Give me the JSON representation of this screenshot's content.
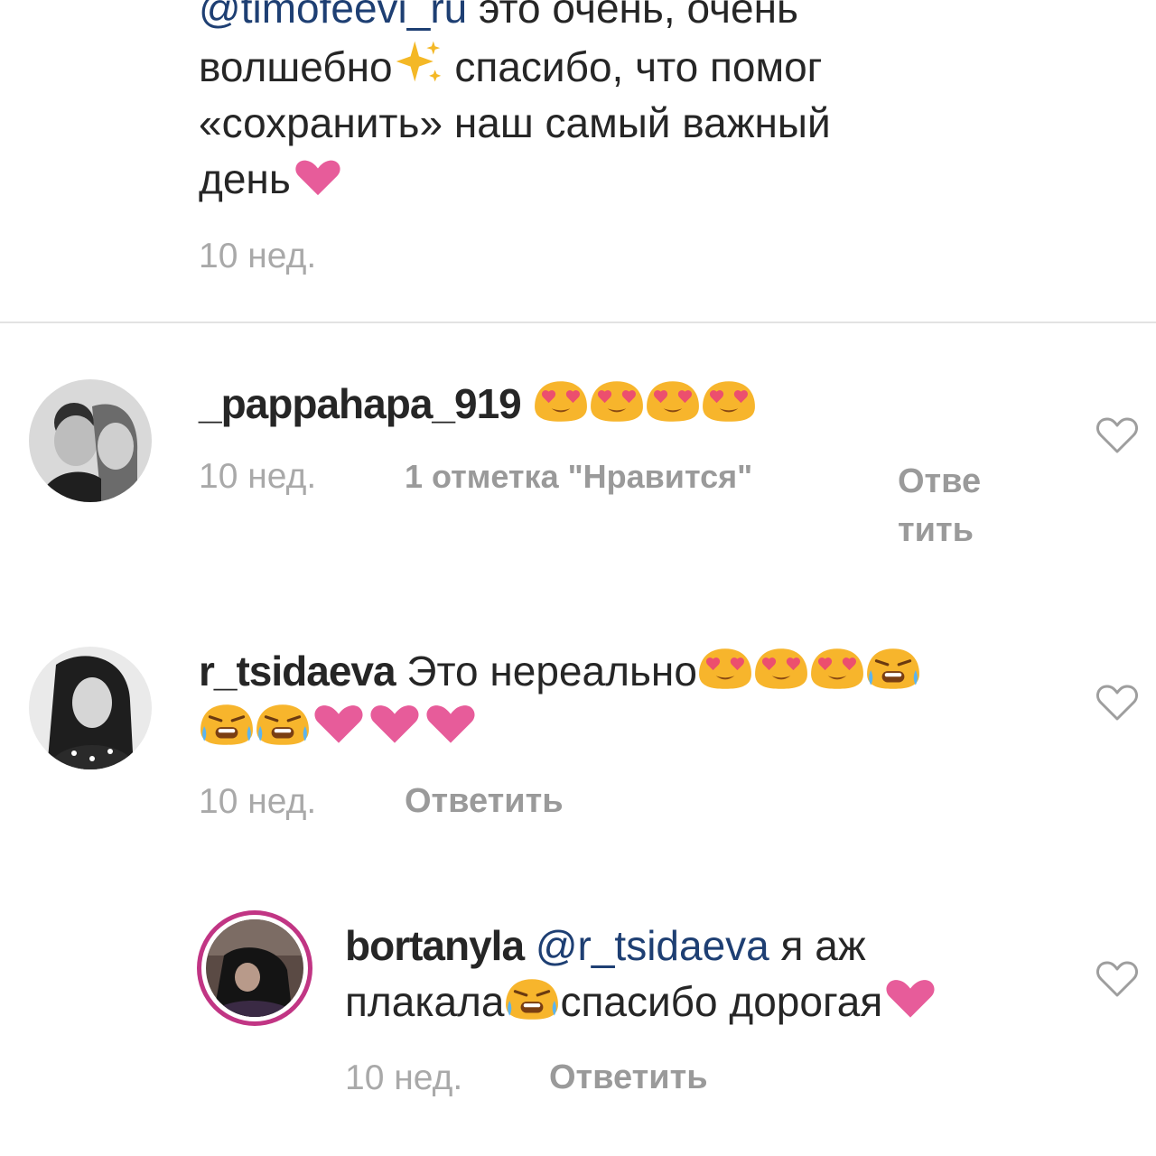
{
  "top_comment": {
    "mention": "@timofeevi_ru",
    "text_1": " это очень, очень",
    "text_2": "волшебно",
    "text_3": " спасибо, что помог",
    "text_4": "«сохранить» наш самый важный",
    "text_5": "день",
    "time": "10 нед."
  },
  "comments": [
    {
      "username": "_pappahapa_919",
      "time": "10 нед.",
      "likes": "1 отметка \"Нравится\"",
      "reply_line1": "Отве",
      "reply_line2": "тить",
      "emojis": [
        "heart-eyes-emoji",
        "heart-eyes-emoji",
        "heart-eyes-emoji",
        "heart-eyes-emoji"
      ]
    },
    {
      "username": "r_tsidaeva",
      "text": " Это нереально",
      "time": "10 нед.",
      "reply": "Ответить",
      "emojis": [
        "heart-eyes-emoji",
        "heart-eyes-emoji",
        "heart-eyes-emoji",
        "crying-face-emoji",
        "crying-face-emoji",
        "crying-face-emoji",
        "pink-heart-emoji",
        "pink-heart-emoji",
        "pink-heart-emoji"
      ]
    },
    {
      "username": "bortanyla",
      "mention": " @r_tsidaeva",
      "text_1": " я аж",
      "text_2": "плакала",
      "text_3": "спасибо дорогая",
      "time": "10 нед.",
      "reply": "Ответить",
      "emojis": [
        "crying-face-emoji",
        "pink-heart-emoji"
      ]
    }
  ],
  "colors": {
    "text": "#262626",
    "mention": "#1e3f73",
    "meta": "#a9a9a9",
    "heart": "#e75c9a",
    "emoji_yellow": "#f7b52c",
    "story_ring": "#c13584"
  },
  "icons": {
    "like": "heart-outline-icon"
  }
}
